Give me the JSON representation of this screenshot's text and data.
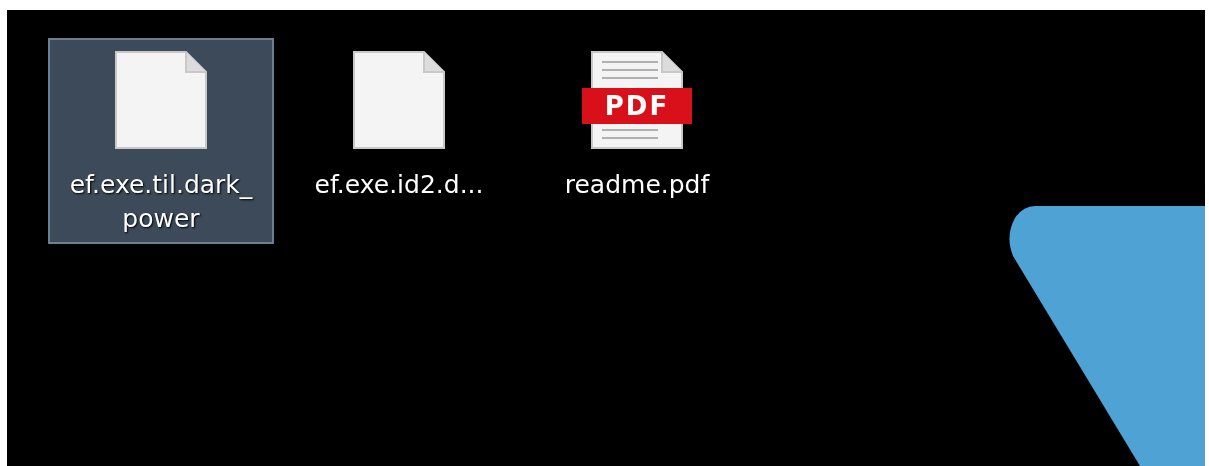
{
  "desktop": {
    "icons": [
      {
        "label": "ef.exe.til.dark_power",
        "kind": "file",
        "selected": true
      },
      {
        "label": "ef.exe.id2.d...",
        "kind": "file",
        "selected": false
      },
      {
        "label": "readme.pdf",
        "kind": "pdf",
        "badge": "PDF",
        "selected": false
      }
    ]
  }
}
